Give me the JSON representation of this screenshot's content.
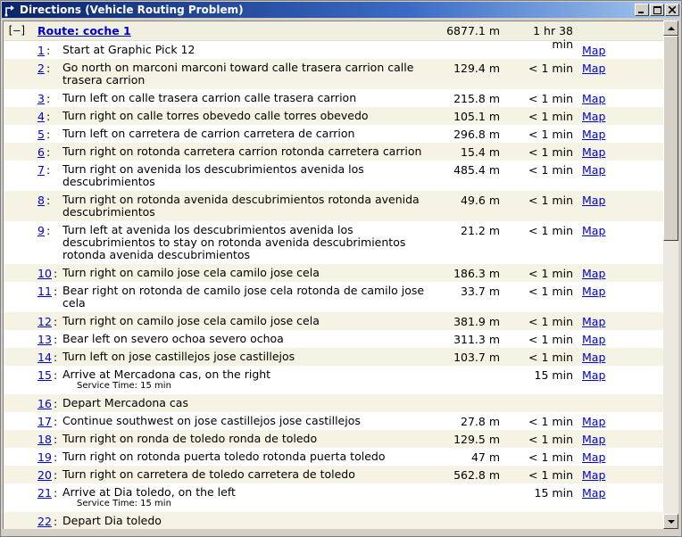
{
  "window": {
    "title": "Directions (Vehicle Routing Problem)",
    "minimize": "_",
    "maximize": "□",
    "close": "×"
  },
  "route": {
    "toggle": "[–]",
    "label": "Route: coche 1",
    "distance": "6877.1 m",
    "time": "1 hr 38 min"
  },
  "map_label": "Map",
  "service_label": "Service Time: 15 min",
  "steps": [
    {
      "num": "1",
      "text": "Start at Graphic Pick 12",
      "dist": "",
      "time": "",
      "map": true
    },
    {
      "num": "2",
      "text": "Go north on marconi marconi toward calle trasera carrion calle trasera carrion",
      "dist": "129.4 m",
      "time": "< 1 min",
      "map": true
    },
    {
      "num": "3",
      "text": "Turn left on calle trasera carrion calle trasera carrion",
      "dist": "215.8 m",
      "time": "< 1 min",
      "map": true
    },
    {
      "num": "4",
      "text": "Turn right on calle torres obevedo calle torres obevedo",
      "dist": "105.1 m",
      "time": "< 1 min",
      "map": true
    },
    {
      "num": "5",
      "text": "Turn left on carretera de carrion carretera de carrion",
      "dist": "296.8 m",
      "time": "< 1 min",
      "map": true
    },
    {
      "num": "6",
      "text": "Turn right on rotonda carretera carrion rotonda carretera carrion",
      "dist": "15.4 m",
      "time": "< 1 min",
      "map": true
    },
    {
      "num": "7",
      "text": "Turn right on avenida los descubrimientos avenida los descubrimientos",
      "dist": "485.4 m",
      "time": "< 1 min",
      "map": true
    },
    {
      "num": "8",
      "text": "Turn right on rotonda avenida descubrimientos rotonda avenida descubrimientos",
      "dist": "49.6 m",
      "time": "< 1 min",
      "map": true
    },
    {
      "num": "9",
      "text": "Turn left at avenida los descubrimientos avenida los descubrimientos to stay on rotonda avenida descubrimientos rotonda avenida descubrimientos",
      "dist": "21.2 m",
      "time": "< 1 min",
      "map": true
    },
    {
      "num": "10",
      "text": "Turn right on camilo jose cela camilo jose cela",
      "dist": "186.3 m",
      "time": "< 1 min",
      "map": true
    },
    {
      "num": "11",
      "text": "Bear right on rotonda de camilo jose cela rotonda de camilo jose cela",
      "dist": "33.7 m",
      "time": "< 1 min",
      "map": true
    },
    {
      "num": "12",
      "text": "Turn right on camilo jose cela camilo jose cela",
      "dist": "381.9 m",
      "time": "< 1 min",
      "map": true
    },
    {
      "num": "13",
      "text": "Bear left on severo ochoa severo ochoa",
      "dist": "311.3 m",
      "time": "< 1 min",
      "map": true
    },
    {
      "num": "14",
      "text": "Turn left on jose castillejos jose castillejos",
      "dist": "103.7 m",
      "time": "< 1 min",
      "map": true
    },
    {
      "num": "15",
      "text": "Arrive at Mercadona cas, on the right",
      "dist": "",
      "time": "15 min",
      "map": true,
      "service": true
    },
    {
      "num": "16",
      "text": "Depart Mercadona cas",
      "dist": "",
      "time": "",
      "map": false
    },
    {
      "num": "17",
      "text": "Continue southwest on jose castillejos jose castillejos",
      "dist": "27.8 m",
      "time": "< 1 min",
      "map": true
    },
    {
      "num": "18",
      "text": "Turn right on ronda de toledo ronda de toledo",
      "dist": "129.5 m",
      "time": "< 1 min",
      "map": true
    },
    {
      "num": "19",
      "text": "Turn right on rotonda puerta toledo rotonda puerta toledo",
      "dist": "47 m",
      "time": "< 1 min",
      "map": true
    },
    {
      "num": "20",
      "text": "Turn right on carretera de toledo carretera de toledo",
      "dist": "562.8 m",
      "time": "< 1 min",
      "map": true
    },
    {
      "num": "21",
      "text": "Arrive at Dia toledo, on the left",
      "dist": "",
      "time": "15 min",
      "map": true,
      "service": true
    },
    {
      "num": "22",
      "text": "Depart Dia toledo",
      "dist": "",
      "time": "",
      "map": false
    }
  ]
}
